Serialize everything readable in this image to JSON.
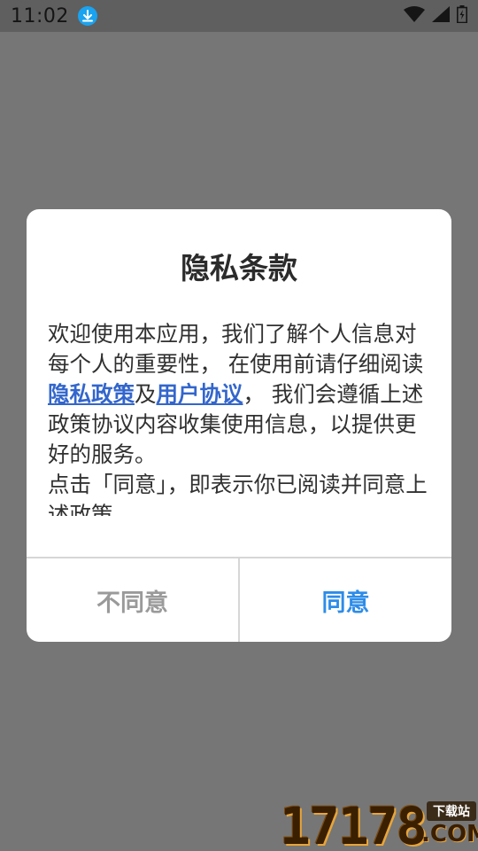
{
  "status_bar": {
    "time": "11:02",
    "icons": [
      "download-icon",
      "wifi-icon",
      "signal-icon",
      "battery-icon"
    ]
  },
  "dialog": {
    "title": "隐私条款",
    "body_part1": "欢迎使用本应用，我们了解个人信息对每个人的重要性， 在使用前请仔细阅读",
    "privacy_link": "隐私政策",
    "and_text": "及",
    "agreement_link": "用户协议",
    "body_part2": "， 我们会遵循上述政策协议内容收集使用信息，以提供更好的服务。",
    "body_part3": "点击「同意」，即表示你已阅读并同意上述政策",
    "disagree_label": "不同意",
    "agree_label": "同意"
  },
  "watermark": {
    "number": "17178",
    "tag": "下载站",
    "domain": ".COM"
  },
  "colors": {
    "overlay": "#7b7b7b",
    "accent": "#2d8ce8",
    "link": "#3366cc",
    "disagree": "#9a9a9a"
  }
}
